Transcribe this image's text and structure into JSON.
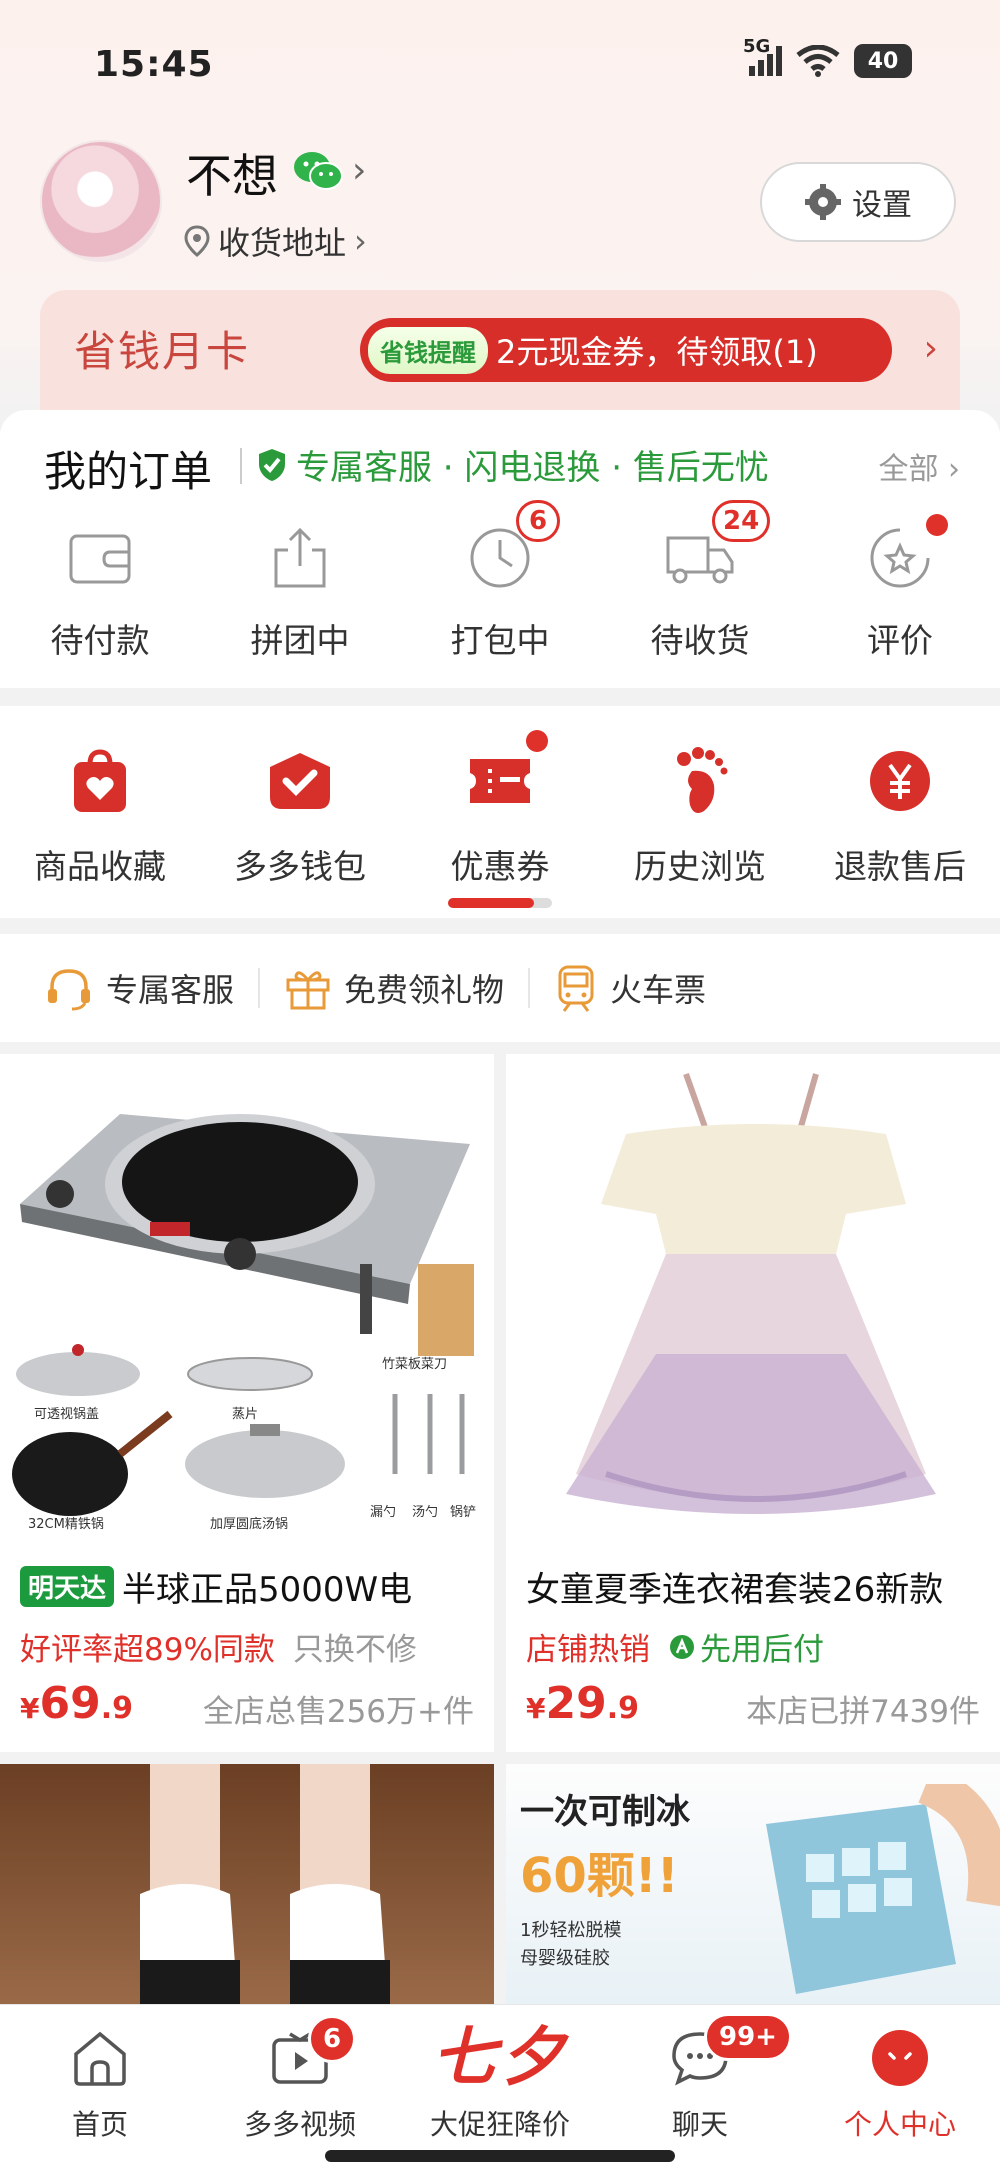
{
  "status_bar": {
    "time": "15:45",
    "network": "5G",
    "battery": "40"
  },
  "profile": {
    "name": "不想",
    "address_label": "收货地址",
    "settings_label": "设置"
  },
  "savings_card": {
    "title": "省钱月卡",
    "tag": "省钱提醒",
    "message": "2元现金券，待领取(1)"
  },
  "orders": {
    "title": "我的订单",
    "promo": "专属客服 · 闪电退换 · 售后无忧",
    "all_label": "全部",
    "items": [
      {
        "label": "待付款",
        "icon": "wallet-icon",
        "badge": ""
      },
      {
        "label": "拼团中",
        "icon": "share-box-icon",
        "badge": ""
      },
      {
        "label": "打包中",
        "icon": "clock-icon",
        "badge": "6"
      },
      {
        "label": "待收货",
        "icon": "truck-icon",
        "badge": "24"
      },
      {
        "label": "评价",
        "icon": "star-review-icon",
        "badge": ""
      }
    ]
  },
  "tools": [
    {
      "label": "商品收藏",
      "icon": "favorite-bag-icon"
    },
    {
      "label": "多多钱包",
      "icon": "wallet-heart-icon"
    },
    {
      "label": "优惠券",
      "icon": "coupon-icon"
    },
    {
      "label": "历史浏览",
      "icon": "footprint-icon"
    },
    {
      "label": "退款售后",
      "icon": "refund-yuan-icon"
    }
  ],
  "services": [
    {
      "label": "专属客服",
      "icon": "headset-icon"
    },
    {
      "label": "免费领礼物",
      "icon": "gift-icon"
    },
    {
      "label": "火车票",
      "icon": "train-icon"
    }
  ],
  "products": [
    {
      "fast_tag": "明天达",
      "title": "半球正品5000W电",
      "tag1": "好评率超89%同款",
      "tag2": "只换不修",
      "price_currency": "¥",
      "price_int": "69",
      "price_dec": ".9",
      "sold": "全店总售256万+件",
      "image_labels": [
        "可透视锅盖",
        "蒸片",
        "竹菜板菜刀",
        "32CM精铁锅",
        "加厚圆底汤锅",
        "漏勺",
        "汤勺",
        "锅铲"
      ]
    },
    {
      "title": "女童夏季连衣裙套装26新款",
      "tag1": "店铺热销",
      "tag2": "先用后付",
      "price_currency": "¥",
      "price_int": "29",
      "price_dec": ".9",
      "sold": "本店已拼7439件"
    }
  ],
  "promo_image": {
    "line1": "一次可制冰",
    "line2": "60颗!!",
    "line3": "1秒轻松脱模",
    "line4": "母婴级硅胶"
  },
  "nav": {
    "items": [
      {
        "label": "首页",
        "icon": "home-icon",
        "badge": ""
      },
      {
        "label": "多多视频",
        "icon": "video-icon",
        "badge": "6"
      },
      {
        "label": "大促狂降价",
        "icon": "qixi-logo",
        "logo_text": "七夕",
        "badge": ""
      },
      {
        "label": "聊天",
        "icon": "chat-icon",
        "badge": "99+"
      },
      {
        "label": "个人中心",
        "icon": "profile-icon",
        "badge": ""
      }
    ]
  },
  "colors": {
    "accent": "#e0302a",
    "green": "#2a9a3a",
    "card_bg": "#f9e2de"
  }
}
